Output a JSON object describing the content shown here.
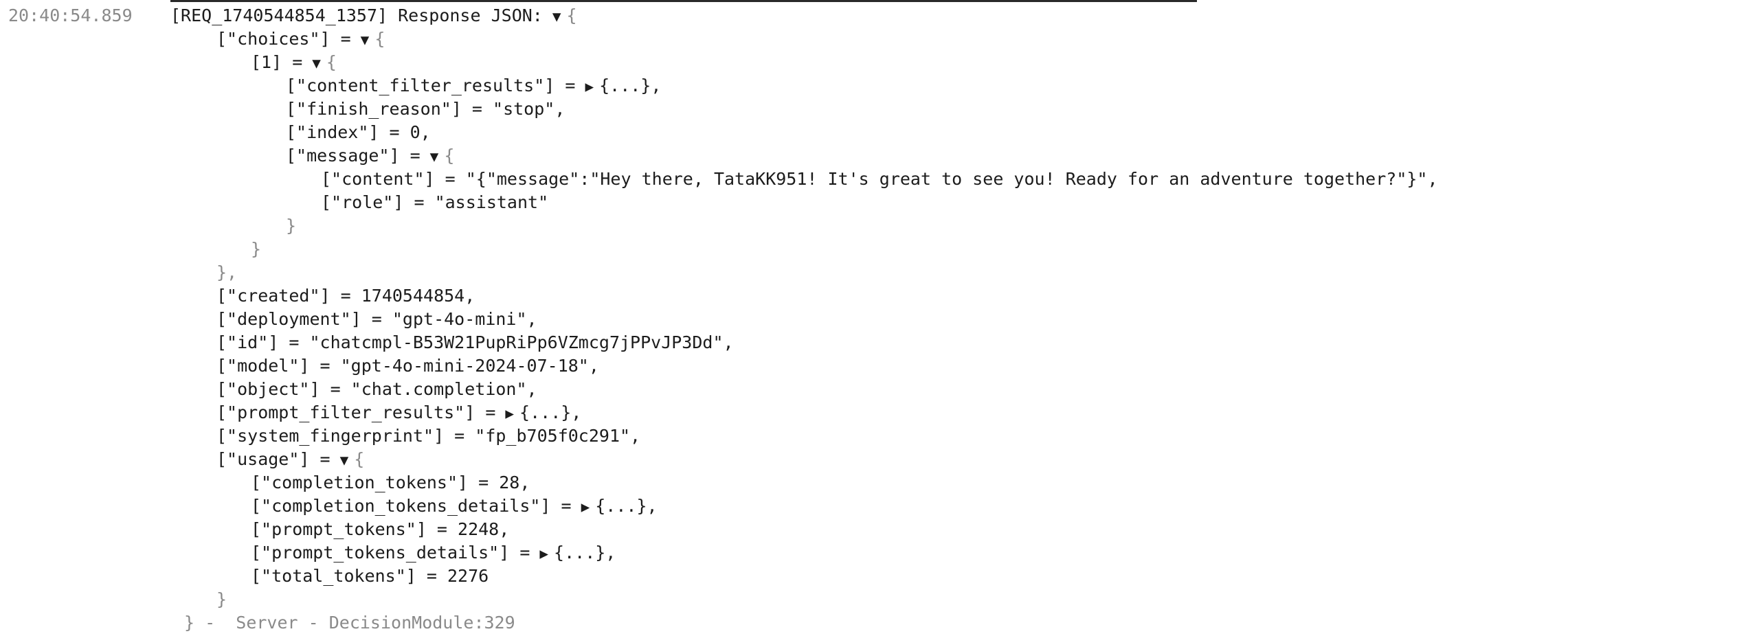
{
  "timestamp": "20:40:54.859",
  "header": {
    "request": "[REQ_1740544854_1357] Response JSON:"
  },
  "glyphs": {
    "expanded": "▼",
    "collapsed": "▶",
    "open": "{",
    "close": "}",
    "close_comma": "},",
    "ellipsis": "{...},"
  },
  "choices": {
    "key": "[\"choices\"] =",
    "item_key": "[1] =",
    "content_filter_key": "[\"content_filter_results\"] =",
    "finish_reason": "[\"finish_reason\"] = \"stop\",",
    "index": "[\"index\"] = 0,",
    "message_key": "[\"message\"] =",
    "message_content": "[\"content\"] = \"{\"message\":\"Hey there, TataKK951! It's great to see you! Ready for an adventure together?\"}\",",
    "message_role": "[\"role\"] = \"assistant\""
  },
  "fields": {
    "created": "[\"created\"] = 1740544854,",
    "deployment": "[\"deployment\"] = \"gpt-4o-mini\",",
    "id": "[\"id\"] = \"chatcmpl-B53W21PupRiPp6VZmcg7jPPvJP3Dd\",",
    "model": "[\"model\"] = \"gpt-4o-mini-2024-07-18\",",
    "object": "[\"object\"] = \"chat.completion\",",
    "prompt_filter_key": "[\"prompt_filter_results\"] =",
    "system_fingerprint": "[\"system_fingerprint\"] = \"fp_b705f0c291\","
  },
  "usage": {
    "key": "[\"usage\"] =",
    "completion_tokens": "[\"completion_tokens\"] = 28,",
    "completion_details_key": "[\"completion_tokens_details\"] =",
    "prompt_tokens": "[\"prompt_tokens\"] = 2248,",
    "prompt_details_key": "[\"prompt_tokens_details\"] =",
    "total_tokens": "[\"total_tokens\"] = 2276"
  },
  "footer": {
    "source": " -  Server - DecisionModule:329"
  }
}
